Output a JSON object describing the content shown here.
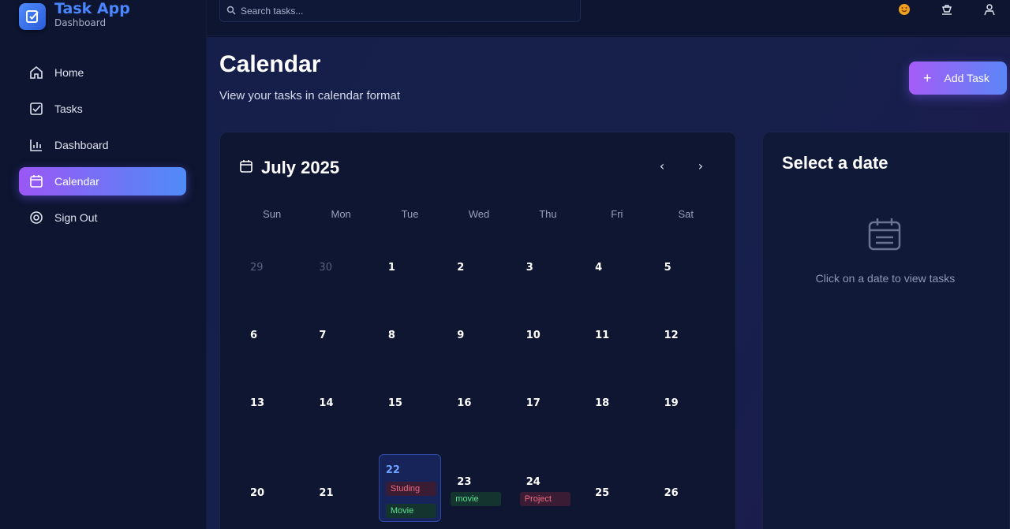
{
  "app": {
    "title": "Task App",
    "subtitle": "Dashboard"
  },
  "sidebar": {
    "items": [
      {
        "label": "Home",
        "icon": "home-icon"
      },
      {
        "label": "Tasks",
        "icon": "checkbox-icon"
      },
      {
        "label": "Dashboard",
        "icon": "bar-chart-icon"
      },
      {
        "label": "Calendar",
        "icon": "calendar-icon",
        "active": true
      },
      {
        "label": "Sign Out",
        "icon": "settings-icon"
      }
    ]
  },
  "search": {
    "placeholder": "Search tasks..."
  },
  "topbar": {
    "icons": [
      "notification-icon",
      "theme-icon",
      "user-icon"
    ]
  },
  "page": {
    "title": "Calendar",
    "subtitle": "View your tasks in calendar format",
    "add_button": "Add Task"
  },
  "calendar": {
    "month_label": "July 2025",
    "weekdays": [
      "Sun",
      "Mon",
      "Tue",
      "Wed",
      "Thu",
      "Fri",
      "Sat"
    ],
    "weeks": [
      [
        "29",
        "30",
        "1",
        "2",
        "3",
        "4",
        "5"
      ],
      [
        "6",
        "7",
        "8",
        "9",
        "10",
        "11",
        "12"
      ],
      [
        "13",
        "14",
        "15",
        "16",
        "17",
        "18",
        "19"
      ],
      [
        "20",
        "21",
        "22",
        "23",
        "24",
        "25",
        "26"
      ]
    ],
    "today": "22",
    "tasks": {
      "d22": [
        "Studing",
        "Movie"
      ],
      "d23": [
        "movie"
      ],
      "d24": [
        "Project"
      ]
    }
  },
  "details": {
    "title": "Select a date",
    "empty_text": "Click on a date to view tasks"
  },
  "colors": {
    "accent_start": "#a55cf7",
    "accent_end": "#5b86f7",
    "brand": "#4a86ff",
    "task_red": "#f06a7e",
    "task_green": "#5ee08f"
  }
}
